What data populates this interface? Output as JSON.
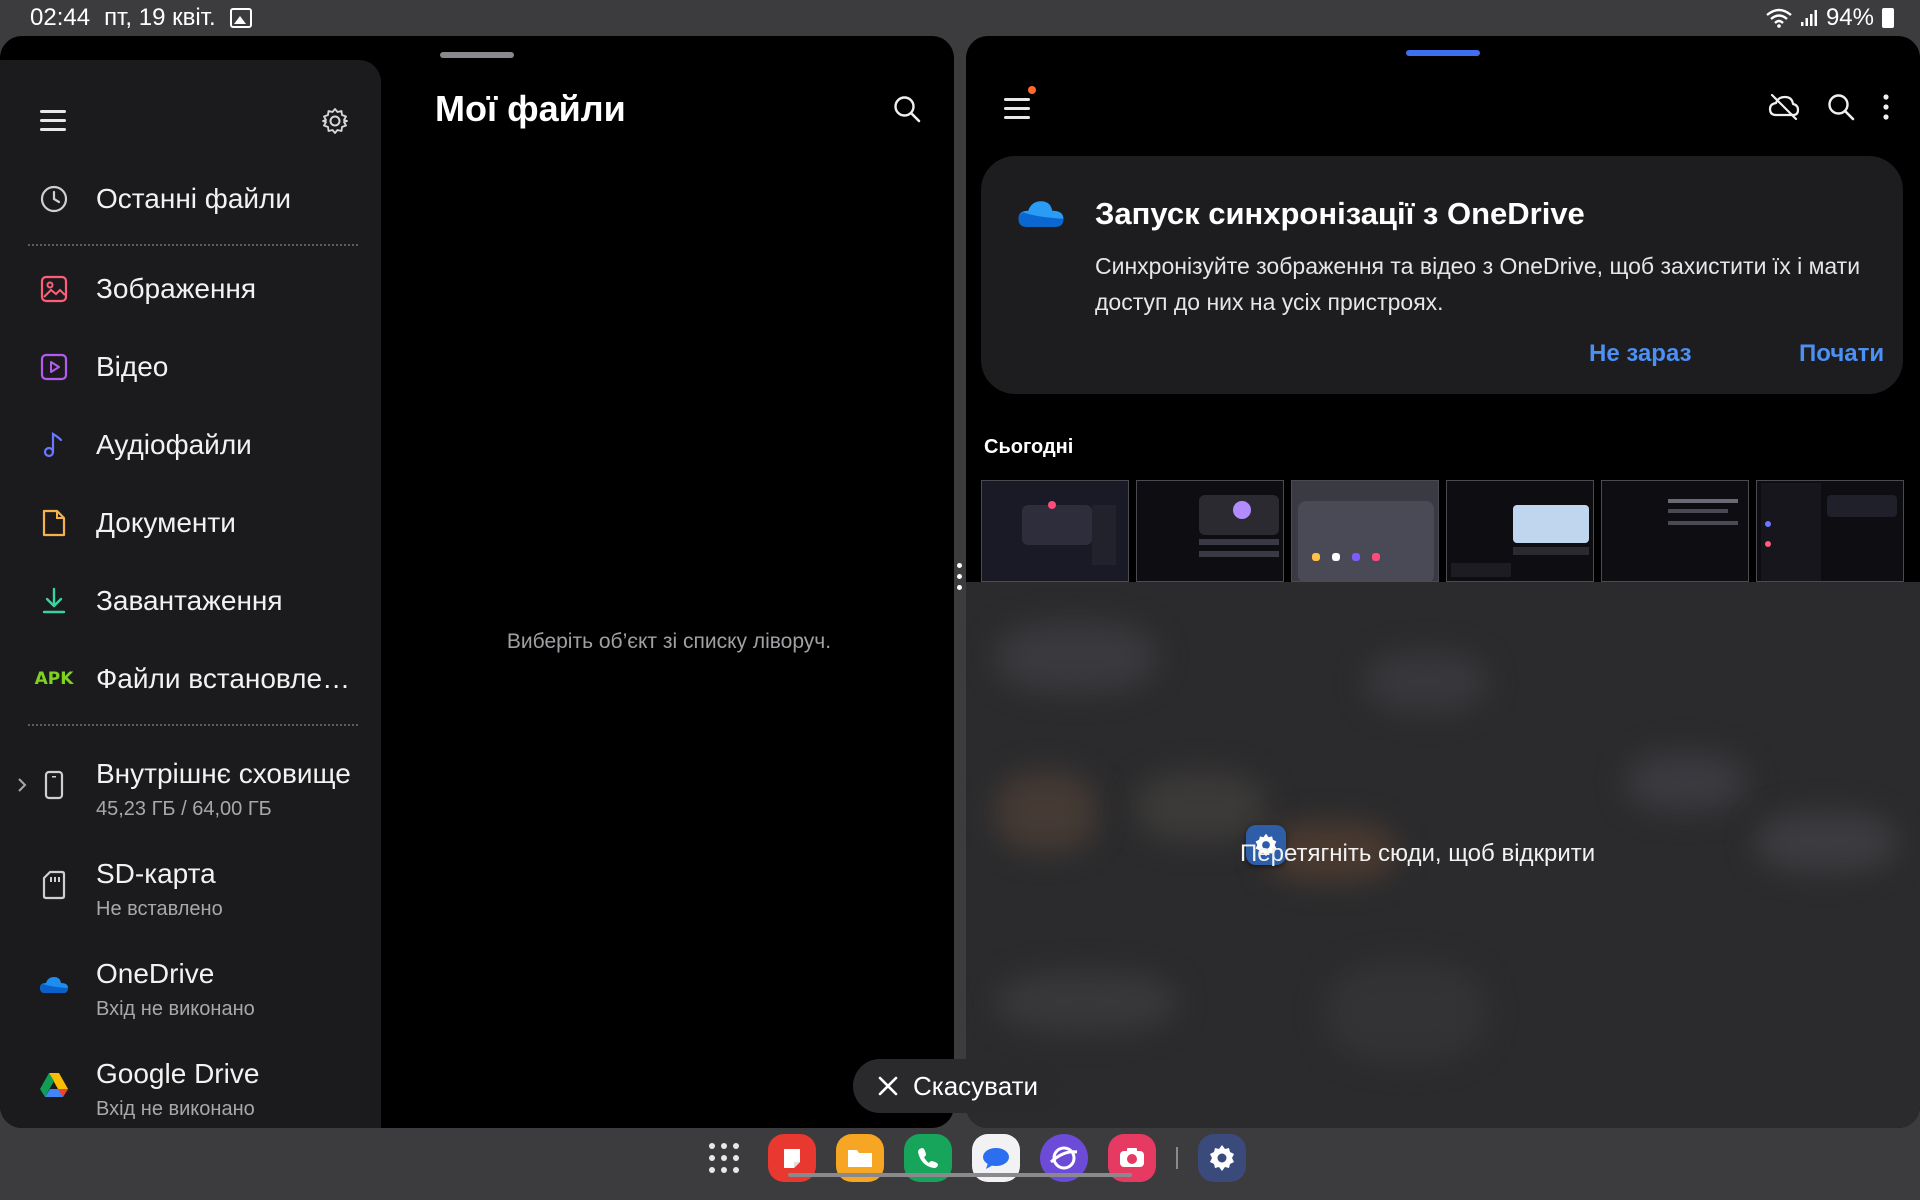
{
  "status": {
    "time": "02:44",
    "date": "пт, 19 квіт.",
    "battery": "94%"
  },
  "left": {
    "title": "Мої файли",
    "empty_hint": "Виберіть об’єкт зі списку ліворуч.",
    "nav": [
      {
        "label": "Останні файли",
        "icon": "clock-icon"
      },
      {
        "label": "Зображення",
        "icon": "image-icon",
        "color": "#ff5d7a"
      },
      {
        "label": "Відео",
        "icon": "video-icon",
        "color": "#b45cf0"
      },
      {
        "label": "Аудіофайли",
        "icon": "music-icon",
        "color": "#6a78ff"
      },
      {
        "label": "Документи",
        "icon": "document-icon",
        "color": "#f6b24a"
      },
      {
        "label": "Завантаження",
        "icon": "download-icon",
        "color": "#38d3a0"
      },
      {
        "label": "Файли встановле…",
        "icon": "apk-icon",
        "badge": "APK"
      }
    ],
    "storage": [
      {
        "label": "Внутрішнє сховище",
        "sub": "45,23 ГБ / 64,00 ГБ",
        "icon": "phone-icon"
      },
      {
        "label": "SD-карта",
        "sub": "Не вставлено",
        "icon": "sd-card-icon"
      },
      {
        "label": "OneDrive",
        "sub": "Вхід не виконано",
        "icon": "onedrive-icon"
      },
      {
        "label": "Google Drive",
        "sub": "Вхід не виконано",
        "icon": "google-drive-icon"
      }
    ]
  },
  "right": {
    "card": {
      "title": "Запуск синхронізації з OneDrive",
      "body": "Синхронізуйте зображення та відео з OneDrive, щоб захистити їх і мати доступ до них на усіх пристроях.",
      "not_now": "Не зараз",
      "start": "Почати"
    },
    "section": "Сьогодні",
    "thumb_count": 6
  },
  "drop": {
    "text": "Перетягніть сюди, щоб відкрити"
  },
  "cancel": "Скасувати",
  "taskbar": [
    "apps-grid-icon",
    "notes-app-icon",
    "my-files-app-icon",
    "phone-app-icon",
    "messages-app-icon",
    "internet-app-icon",
    "screen-recorder-app-icon",
    "settings-app-icon"
  ],
  "colors": {
    "accent": "#4a90f5",
    "handle_active": "#3e6ff0"
  }
}
